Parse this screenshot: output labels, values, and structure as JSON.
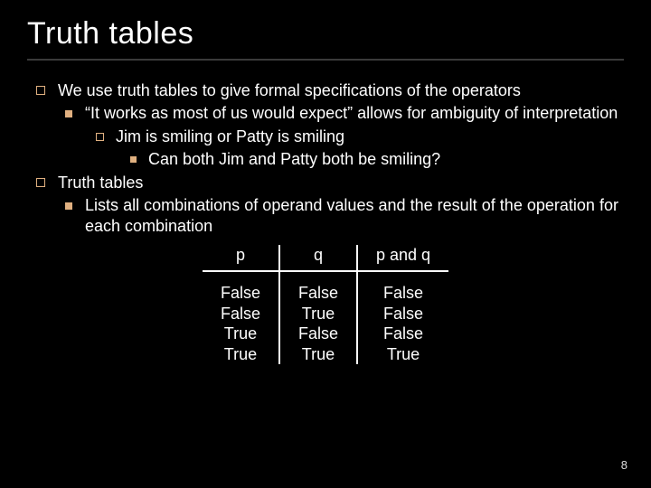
{
  "title": "Truth tables",
  "bullets": {
    "b1": "We use truth tables to give formal specifications of the operators",
    "b1a": "“It works as most of us would expect” allows for ambiguity of interpretation",
    "b1a1": "Jim is smiling or Patty is smiling",
    "b1a1a": "Can both Jim and Patty both be smiling?",
    "b2": "Truth tables",
    "b2a": "Lists all combinations of operand values and the result of the operation for each combination"
  },
  "chart_data": {
    "type": "table",
    "columns": [
      "p",
      "q",
      "p and q"
    ],
    "rows": [
      [
        "False",
        "False",
        "False"
      ],
      [
        "False",
        "True",
        "False"
      ],
      [
        "True",
        "False",
        "False"
      ],
      [
        "True",
        "True",
        "True"
      ]
    ]
  },
  "page_number": "8"
}
